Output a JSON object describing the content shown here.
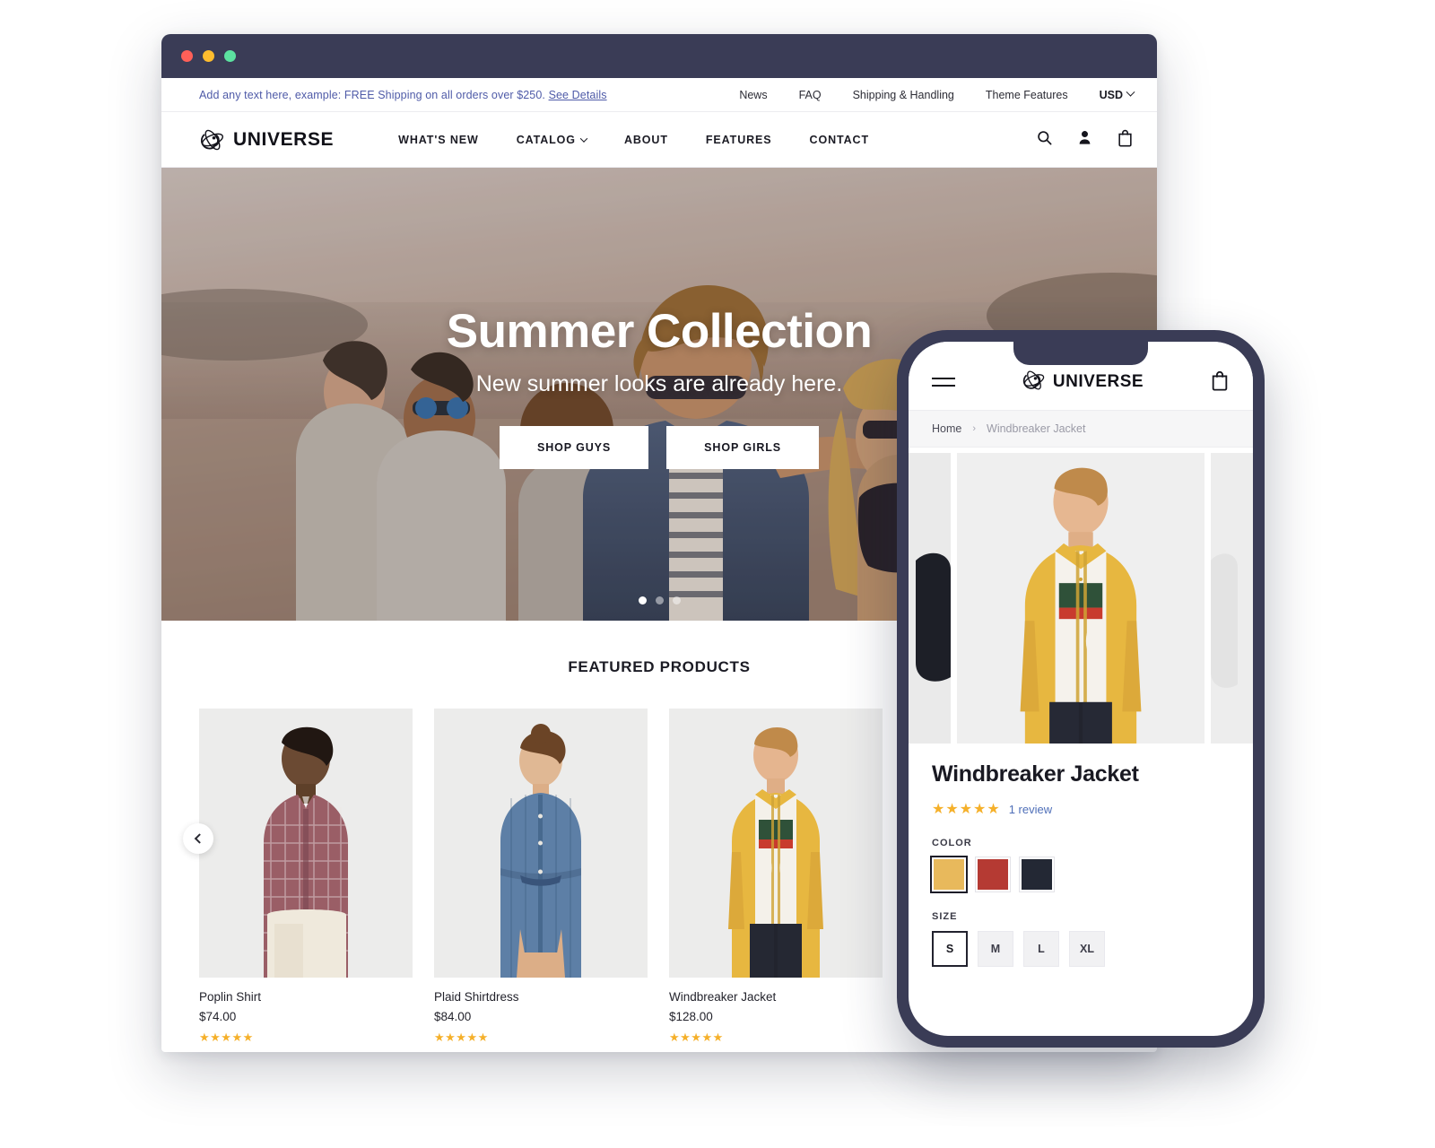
{
  "window": {
    "traffic_lights": [
      "close",
      "minimize",
      "maximize"
    ]
  },
  "announcement": {
    "text": "Add any text here, example: FREE Shipping on all orders over $250.",
    "link_label": "See Details",
    "links": [
      {
        "label": "News"
      },
      {
        "label": "FAQ"
      },
      {
        "label": "Shipping & Handling"
      },
      {
        "label": "Theme Features"
      }
    ],
    "currency": "USD"
  },
  "header": {
    "brand": "UNIVERSE",
    "logo_icon": "atom-icon",
    "nav": [
      {
        "label": "WHAT'S NEW",
        "has_dropdown": false
      },
      {
        "label": "CATALOG",
        "has_dropdown": true
      },
      {
        "label": "ABOUT",
        "has_dropdown": false
      },
      {
        "label": "FEATURES",
        "has_dropdown": false
      },
      {
        "label": "CONTACT",
        "has_dropdown": false
      }
    ],
    "icons": [
      {
        "name": "search-icon"
      },
      {
        "name": "account-icon"
      },
      {
        "name": "bag-icon"
      }
    ]
  },
  "hero": {
    "title": "Summer Collection",
    "subtitle": "New summer looks are already here.",
    "buttons": [
      {
        "label": "SHOP GUYS"
      },
      {
        "label": "SHOP GIRLS"
      }
    ],
    "slides": 3,
    "active_slide": 1
  },
  "featured": {
    "heading": "FEATURED PRODUCTS",
    "prev_label": "‹",
    "products": [
      {
        "name": "Poplin Shirt",
        "price": "$74.00",
        "stars": "★★★★★"
      },
      {
        "name": "Plaid Shirtdress",
        "price": "$84.00",
        "stars": "★★★★★"
      },
      {
        "name": "Windbreaker Jacket",
        "price": "$128.00",
        "stars": "★★★★★"
      }
    ]
  },
  "phone": {
    "brand": "UNIVERSE",
    "menu_icon": "hamburger-icon",
    "bag_icon": "bag-icon",
    "breadcrumb": {
      "home": "Home",
      "separator": "›",
      "current": "Windbreaker Jacket"
    },
    "product": {
      "title": "Windbreaker Jacket",
      "stars": "★★★★★",
      "review_count": "1 review",
      "color_label": "COLOR",
      "colors": [
        {
          "name": "yellow",
          "hex": "#e8b95c",
          "selected": true
        },
        {
          "name": "red",
          "hex": "#b53a33",
          "selected": false
        },
        {
          "name": "navy",
          "hex": "#232834",
          "selected": false
        }
      ],
      "size_label": "SIZE",
      "sizes": [
        {
          "label": "S",
          "selected": true
        },
        {
          "label": "M",
          "selected": false
        },
        {
          "label": "L",
          "selected": false
        },
        {
          "label": "XL",
          "selected": false
        }
      ]
    }
  },
  "theme": {
    "chrome": "#3a3c56",
    "star": "#f5b02a",
    "link": "#4f5ba8",
    "review_link": "#4f6fb8"
  }
}
